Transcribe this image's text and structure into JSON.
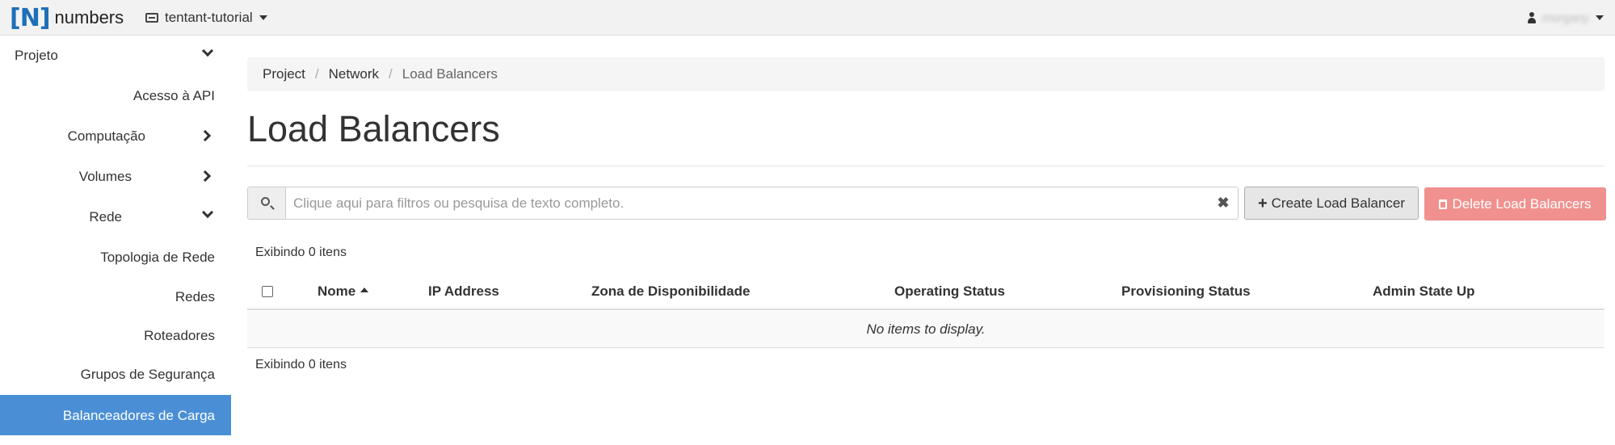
{
  "topbar": {
    "logo_mark": "[N]",
    "logo_text": "numbers",
    "project_name": "tentant-tutorial",
    "user_name": "morgany"
  },
  "sidebar": {
    "items": [
      {
        "label": "Projeto",
        "chevron": "chevron-down-icon",
        "active": false
      },
      {
        "label": "Acesso à API",
        "chevron": null,
        "active": false
      },
      {
        "label": "Computação",
        "chevron": "chevron-right-icon",
        "active": false
      },
      {
        "label": "Volumes",
        "chevron": "chevron-right-icon",
        "active": false
      },
      {
        "label": "Rede",
        "chevron": "chevron-down-icon",
        "active": false
      },
      {
        "label": "Topologia de Rede",
        "chevron": null,
        "active": false
      },
      {
        "label": "Redes",
        "chevron": null,
        "active": false
      },
      {
        "label": "Roteadores",
        "chevron": null,
        "active": false
      },
      {
        "label": "Grupos de Segurança",
        "chevron": null,
        "active": false
      },
      {
        "label": "Balanceadores de Carga",
        "chevron": null,
        "active": true
      }
    ]
  },
  "breadcrumb": {
    "items": [
      "Project",
      "Network",
      "Load Balancers"
    ],
    "separator": "/"
  },
  "main": {
    "title": "Load Balancers",
    "search": {
      "placeholder": "Clique aqui para filtros ou pesquisa de texto completo.",
      "value": "",
      "clear_glyph": "✖"
    },
    "create_button": "Create Load Balancer",
    "delete_button": "Delete Load Balancers",
    "count_top": "Exibindo 0 itens",
    "count_bottom": "Exibindo 0 itens",
    "table": {
      "columns": [
        "Nome",
        "IP Address",
        "Zona de Disponibilidade",
        "Operating Status",
        "Provisioning Status",
        "Admin State Up"
      ],
      "sorted_column": "Nome",
      "sort_direction": "ascending",
      "empty_message": "No items to display."
    }
  },
  "colors": {
    "active_sidebar": "#4a8fd6",
    "danger_button": "#f0918f",
    "logo_blue": "#1e6fb8"
  }
}
